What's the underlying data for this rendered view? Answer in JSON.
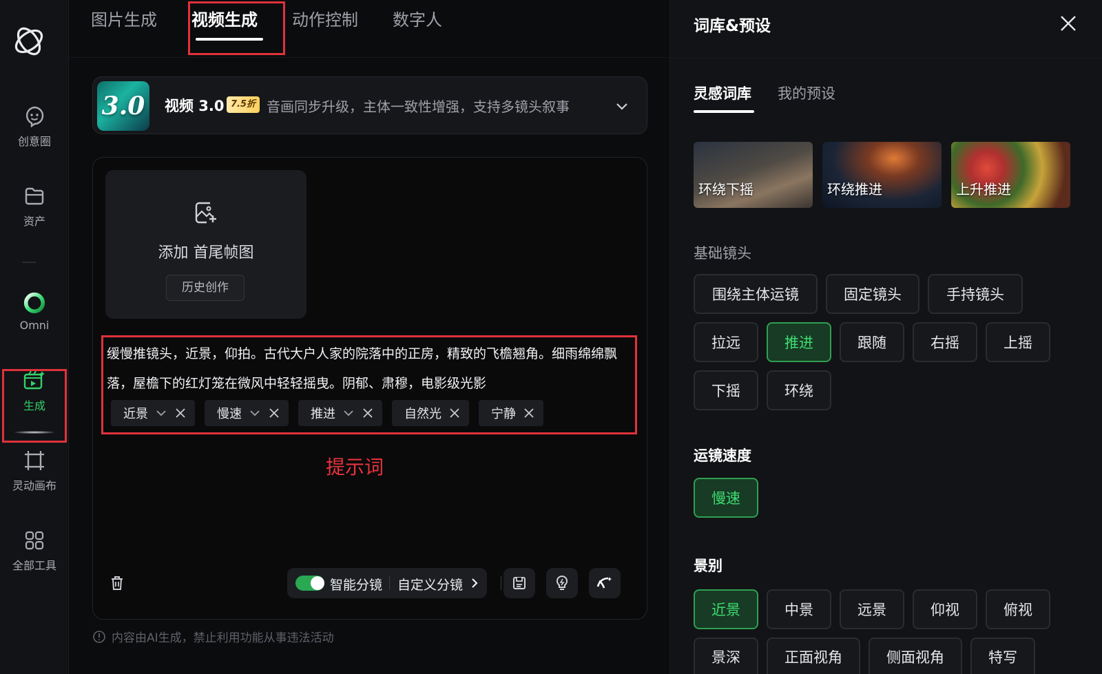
{
  "sidebar": {
    "items": [
      {
        "label": "创意圈",
        "icon": "chat-smile-icon"
      },
      {
        "label": "资产",
        "icon": "folder-icon"
      },
      {
        "label": "Omni",
        "icon": "omni-ring-icon"
      },
      {
        "label": "生成",
        "icon": "generate-icon"
      },
      {
        "label": "灵动画布",
        "icon": "canvas-frame-icon"
      },
      {
        "label": "全部工具",
        "icon": "grid-icon"
      }
    ],
    "active_color": "#35d06a"
  },
  "tabs": [
    "图片生成",
    "视频生成",
    "动作控制",
    "数字人"
  ],
  "model": {
    "thumb_text": "3.0",
    "name": "视频 3.0",
    "badge": "7.5折",
    "description": "音画同步升级，主体一致性增强，支持多镜头叙事"
  },
  "upload": {
    "title": "添加 首尾帧图",
    "history_button": "历史创作"
  },
  "prompt": {
    "text": "缓慢推镜头，近景，仰拍。古代大户人家的院落中的正房，精致的飞檐翘角。细雨绵绵飘落，屋檐下的红灯笼在微风中轻轻摇曳。阴郁、肃穆，电影级光影",
    "chips": [
      {
        "label": "近景",
        "dropdown": true
      },
      {
        "label": "慢速",
        "dropdown": true
      },
      {
        "label": "推进",
        "dropdown": true
      },
      {
        "label": "自然光",
        "dropdown": false
      },
      {
        "label": "宁静",
        "dropdown": false
      }
    ],
    "annotation": "提示词",
    "annotation_color": "#e8333d"
  },
  "toolbar": {
    "smart_split": "智能分镜",
    "custom_split": "自定义分镜",
    "smart_split_on": true
  },
  "footnote": "内容由AI生成，禁止利用功能从事违法活动",
  "panel": {
    "title": "词库&预设",
    "tabs": [
      "灵感词库",
      "我的预设"
    ],
    "thumbnails": [
      "环绕下摇",
      "环绕推进",
      "上升推进"
    ],
    "sections": {
      "basic": {
        "title": "基础镜头",
        "rows": [
          [
            "围绕主体运镜",
            "固定镜头",
            "手持镜头"
          ],
          [
            "拉远",
            "推进",
            "跟随",
            "右摇",
            "上摇"
          ],
          [
            "下摇",
            "环绕"
          ]
        ],
        "selected": "推进"
      },
      "speed": {
        "title": "运镜速度",
        "items": [
          "慢速"
        ],
        "selected": "慢速"
      },
      "shot": {
        "title": "景别",
        "rows": [
          [
            "近景",
            "中景",
            "远景",
            "仰视",
            "俯视"
          ],
          [
            "景深",
            "正面视角",
            "侧面视角",
            "特写"
          ]
        ],
        "selected": "近景"
      }
    },
    "accent_color": "#3fdc72"
  }
}
